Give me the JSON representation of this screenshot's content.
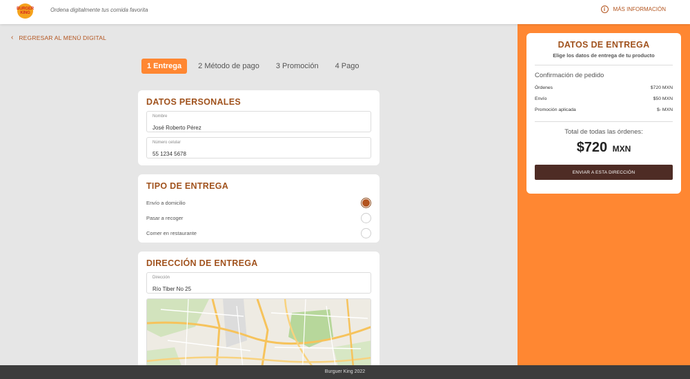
{
  "brand": {
    "logo_top": "BURGER",
    "logo_bottom": "KING",
    "tagline": "Ordena digitalmente tus comida favorita"
  },
  "header": {
    "more_info": "MÁS INFORMACIÓN"
  },
  "nav": {
    "back": "REGRESAR AL MENÚ DIGITAL"
  },
  "steps": [
    {
      "label": "1 Entrega",
      "active": true
    },
    {
      "label": "2 Método de pago",
      "active": false
    },
    {
      "label": "3 Promoción",
      "active": false
    },
    {
      "label": "4 Pago",
      "active": false
    }
  ],
  "personal": {
    "title": "DATOS PERSONALES",
    "name_label": "Nombre",
    "name_value": "José Roberto Pérez",
    "phone_label": "Número celular",
    "phone_value": "55 1234 5678"
  },
  "delivery_type": {
    "title": "TIPO DE ENTREGA",
    "options": [
      {
        "label": "Envío a domicilio",
        "selected": true
      },
      {
        "label": "Pasar a recoger",
        "selected": false
      },
      {
        "label": "Comer en restaurante",
        "selected": false
      }
    ]
  },
  "address": {
    "title": "DIRECCIÓN DE ENTREGA",
    "label": "Dirección",
    "value": "Río Tiber No 25"
  },
  "summary": {
    "title": "DATOS DE ENTREGA",
    "subtitle": "Elige los datos de entrega de tu producto",
    "confirm_title": "Confirmación de pedido",
    "rows": [
      {
        "label": "Órdenes",
        "value": "$720 MXN"
      },
      {
        "label": "Envío",
        "value": "$50 MXN"
      },
      {
        "label": "Promoción aplicada",
        "value": "$- MXN"
      }
    ],
    "total_label": "Total de todas las órdenes:",
    "total_amount": "$720",
    "total_currency": "MXN",
    "button": "ENVIAR A ESTA DIRECCIÓN"
  },
  "footer": {
    "text": "Burguer King 2022"
  },
  "colors": {
    "accent": "#ff8732",
    "title_brown": "#a0521d",
    "button_dark": "#4e2c25",
    "footer": "#3c3c3c"
  }
}
